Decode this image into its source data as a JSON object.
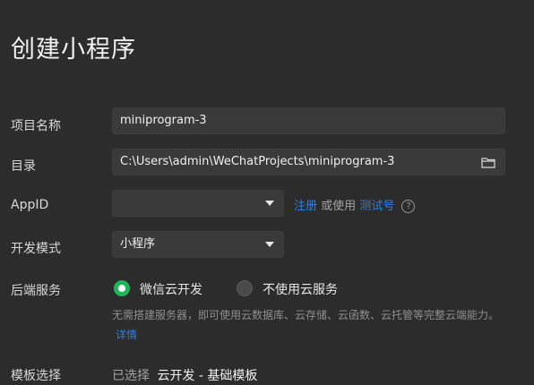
{
  "page": {
    "title": "创建小程序"
  },
  "form": {
    "project_name": {
      "label": "项目名称",
      "value": "miniprogram-3"
    },
    "directory": {
      "label": "目录",
      "value": "C:\\Users\\admin\\WeChatProjects\\miniprogram-3",
      "icon": "folder-icon"
    },
    "appid": {
      "label": "AppID",
      "value": "",
      "register_link": "注册",
      "or_use": "或使用",
      "test_link": "测试号",
      "help_icon": "question-circle-icon",
      "help_glyph": "?"
    },
    "dev_mode": {
      "label": "开发模式",
      "value": "小程序"
    },
    "backend": {
      "label": "后端服务",
      "options": [
        {
          "label": "微信云开发",
          "checked": true
        },
        {
          "label": "不使用云服务",
          "checked": false
        }
      ],
      "description": "无需搭建服务器，即可使用云数据库、云存储、云函数、云托管等完整云端能力。",
      "details_link": "详情"
    },
    "template": {
      "label": "模板选择",
      "selected_prefix": "已选择",
      "selected_value": "云开发 - 基础模板"
    }
  },
  "colors": {
    "background": "#2c2c2c",
    "field": "#3a3a3a",
    "link": "#2f7fe0",
    "radio_checked": "#1fb55a"
  }
}
